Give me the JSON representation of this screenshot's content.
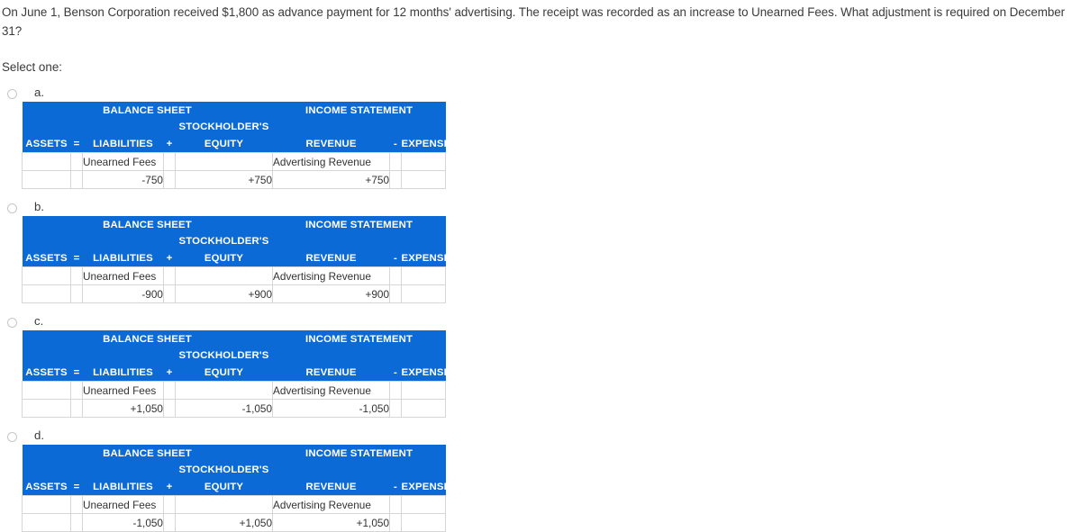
{
  "question": {
    "text": "On June 1, Benson Corporation received $1,800 as advance payment for 12 months' advertising.  The receipt was recorded as an increase to Unearned Fees. What adjustment is required on December 31?",
    "select_prompt": "Select one:"
  },
  "table_headers": {
    "balance_sheet": "BALANCE SHEET",
    "income_statement": "INCOME STATEMENT",
    "stockholders": "STOCKHOLDER'S",
    "assets": "ASSETS",
    "equals": "=",
    "liabilities": "LIABILITIES",
    "plus": "+",
    "equity": "EQUITY",
    "revenue": "REVENUE",
    "minus": "-",
    "expense": "EXPENSE"
  },
  "colors": {
    "header_blue": "#0c6ad6",
    "grid_gray": "#d6d6d6",
    "text": "#3a3a3a"
  },
  "options": [
    {
      "letter": "a.",
      "selected": false,
      "account_row": {
        "assets": "",
        "equals": "",
        "liabilities": "Unearned Fees",
        "plus": "",
        "equity": "",
        "revenue": "Advertising Revenue",
        "minus": "",
        "expense": ""
      },
      "amount_row": {
        "assets": "",
        "equals": "",
        "liabilities": "-750",
        "plus": "",
        "equity": "+750",
        "revenue": "+750",
        "minus": "",
        "expense": ""
      }
    },
    {
      "letter": "b.",
      "selected": false,
      "account_row": {
        "assets": "",
        "equals": "",
        "liabilities": "Unearned Fees",
        "plus": "",
        "equity": "",
        "revenue": "Advertising Revenue",
        "minus": "",
        "expense": ""
      },
      "amount_row": {
        "assets": "",
        "equals": "",
        "liabilities": "-900",
        "plus": "",
        "equity": "+900",
        "revenue": "+900",
        "minus": "",
        "expense": ""
      }
    },
    {
      "letter": "c.",
      "selected": false,
      "account_row": {
        "assets": "",
        "equals": "",
        "liabilities": "Unearned Fees",
        "plus": "",
        "equity": "",
        "revenue": "Advertising Revenue",
        "minus": "",
        "expense": ""
      },
      "amount_row": {
        "assets": "",
        "equals": "",
        "liabilities": "+1,050",
        "plus": "",
        "equity": "-1,050",
        "revenue": "-1,050",
        "minus": "",
        "expense": ""
      }
    },
    {
      "letter": "d.",
      "selected": false,
      "account_row": {
        "assets": "",
        "equals": "",
        "liabilities": "Unearned Fees",
        "plus": "",
        "equity": "",
        "revenue": "Advertising Revenue",
        "minus": "",
        "expense": ""
      },
      "amount_row": {
        "assets": "",
        "equals": "",
        "liabilities": "-1,050",
        "plus": "",
        "equity": "+1,050",
        "revenue": "+1,050",
        "minus": "",
        "expense": ""
      }
    }
  ]
}
